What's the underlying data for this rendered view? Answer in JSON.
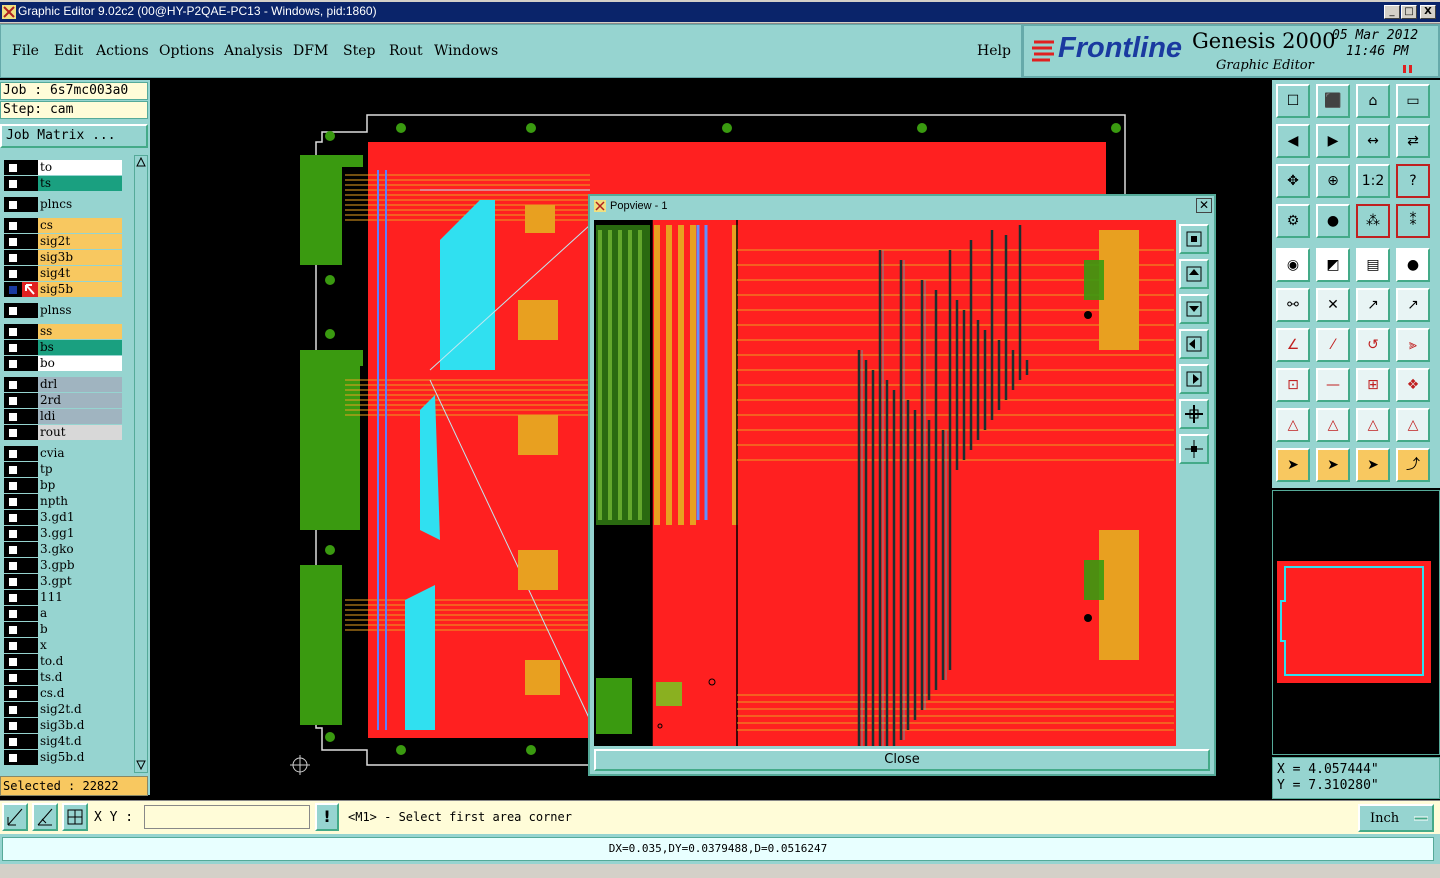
{
  "window": {
    "title": "Graphic Editor 9.02c2 (00@HY-P2QAE-PC13 - Windows, pid:1860)",
    "controls": [
      "_",
      "□",
      "X"
    ]
  },
  "menu": [
    "File",
    "Edit",
    "Actions",
    "Options",
    "Analysis",
    "DFM",
    "Step",
    "Rout",
    "Windows"
  ],
  "help_label": "Help",
  "brand": {
    "logo": "Frontline",
    "product": "Genesis 2000",
    "subtitle": "Graphic Editor",
    "date": "05 Mar 2012",
    "time": "11:46 PM"
  },
  "job_info": {
    "job": "Job : 6s7mc003a0",
    "step": "Step: cam",
    "matrix_button": "Job Matrix ..."
  },
  "layers": [
    {
      "name": "to",
      "color": "#ffffff"
    },
    {
      "name": "ts",
      "color": "#1aa080"
    },
    {
      "name": "plncs",
      "color": "#96d4d0"
    },
    {
      "name": "cs",
      "color": "#f8c860"
    },
    {
      "name": "sig2t",
      "color": "#f8c860"
    },
    {
      "name": "sig3b",
      "color": "#f8c860"
    },
    {
      "name": "sig4t",
      "color": "#f8c860"
    },
    {
      "name": "sig5b",
      "color": "#f8c860"
    },
    {
      "name": "plnss",
      "color": "#96d4d0"
    },
    {
      "name": "ss",
      "color": "#f8c860"
    },
    {
      "name": "bs",
      "color": "#1aa080"
    },
    {
      "name": "bo",
      "color": "#ffffff"
    },
    {
      "name": "drl",
      "color": "#a0b4c0"
    },
    {
      "name": "2rd",
      "color": "#a0b4c0"
    },
    {
      "name": "ldi",
      "color": "#a0b4c0"
    },
    {
      "name": "rout",
      "color": "#d8d8d8"
    },
    {
      "name": "cvia",
      "color": "#96d4d0"
    },
    {
      "name": "tp",
      "color": "#96d4d0"
    },
    {
      "name": "bp",
      "color": "#96d4d0"
    },
    {
      "name": "npth",
      "color": "#96d4d0"
    },
    {
      "name": "3.gd1",
      "color": "#96d4d0"
    },
    {
      "name": "3.gg1",
      "color": "#96d4d0"
    },
    {
      "name": "3.gko",
      "color": "#96d4d0"
    },
    {
      "name": "3.gpb",
      "color": "#96d4d0"
    },
    {
      "name": "3.gpt",
      "color": "#96d4d0"
    },
    {
      "name": "111",
      "color": "#96d4d0"
    },
    {
      "name": "a",
      "color": "#96d4d0"
    },
    {
      "name": "b",
      "color": "#96d4d0"
    },
    {
      "name": "x",
      "color": "#96d4d0"
    },
    {
      "name": "to.d",
      "color": "#96d4d0"
    },
    {
      "name": "ts.d",
      "color": "#96d4d0"
    },
    {
      "name": "cs.d",
      "color": "#96d4d0"
    },
    {
      "name": "sig2t.d",
      "color": "#96d4d0"
    },
    {
      "name": "sig3b.d",
      "color": "#96d4d0"
    },
    {
      "name": "sig4t.d",
      "color": "#96d4d0"
    },
    {
      "name": "sig5b.d",
      "color": "#96d4d0"
    }
  ],
  "selected": "Selected : 22822",
  "popview": {
    "title": "Popview - 1",
    "close_label": "Close"
  },
  "coordinates": {
    "x": "X = 4.057444\"",
    "y": "Y = 7.310280\""
  },
  "bottom": {
    "xy_label": "X Y :",
    "xy_value": "",
    "prompt": "<M1> - Select first area corner",
    "units": "Inch"
  },
  "status": "DX=0.035,DY=0.0379488,D=0.0516247",
  "colors": {
    "panel": "#96d4d0",
    "copper": "#ff2020",
    "trace": "#e8a020",
    "pad_green": "#3a9a10",
    "cyan": "#30e0f0"
  }
}
